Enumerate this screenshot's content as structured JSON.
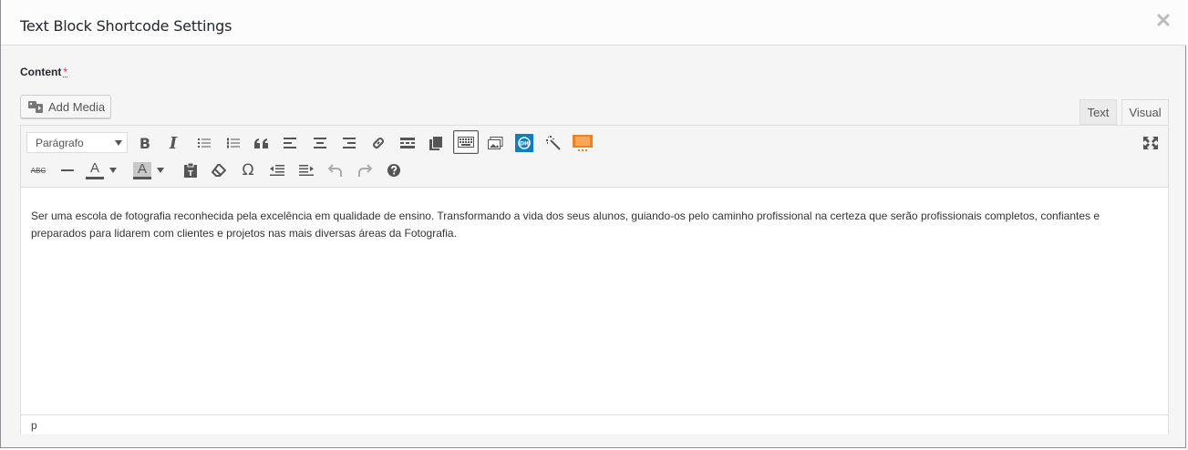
{
  "dialog": {
    "title": "Text Block Shortcode Settings",
    "close_icon": "close-icon"
  },
  "field": {
    "label": "Content",
    "required_mark": "*"
  },
  "media": {
    "add_label": "Add Media"
  },
  "tabs": [
    {
      "label": "Text",
      "active": false
    },
    {
      "label": "Visual",
      "active": true
    }
  ],
  "toolbar": {
    "format_select": "Parágrafo",
    "row1_icons": [
      "bold-icon",
      "italic-icon",
      "bullet-list-icon",
      "numbered-list-icon",
      "blockquote-icon",
      "align-left-icon",
      "align-center-icon",
      "align-right-icon",
      "link-icon",
      "read-more-icon",
      "copy-icon",
      "toolbar-toggle-icon",
      "gallery-icon",
      "plugin-badge-icon",
      "magic-wand-icon",
      "slider-icon",
      "fullscreen-icon"
    ],
    "row2_icons": [
      "strikethrough-icon",
      "horizontal-line-icon",
      "text-color-icon",
      "background-color-icon",
      "paste-text-icon",
      "clear-formatting-icon",
      "special-character-icon",
      "outdent-icon",
      "indent-icon",
      "undo-icon",
      "redo-icon",
      "help-icon"
    ],
    "bold_glyph": "B",
    "italic_glyph": "I",
    "text_color_glyph": "A",
    "bg_color_glyph": "A",
    "omega_glyph": "Ω",
    "abc_glyph": "ABC",
    "accent_orange": "#f0821e",
    "accent_blue": "#0e7ec0"
  },
  "editor": {
    "content": "Ser uma escola de fotografia reconhecida pela excelência em qualidade de ensino. Transformando a vida dos seus alunos, guiando-os pelo caminho profissional na certeza que serão profissionais completos, confiantes e preparados para lidarem com clientes e projetos nas mais diversas áreas da Fotografia.",
    "status_path": "p"
  }
}
